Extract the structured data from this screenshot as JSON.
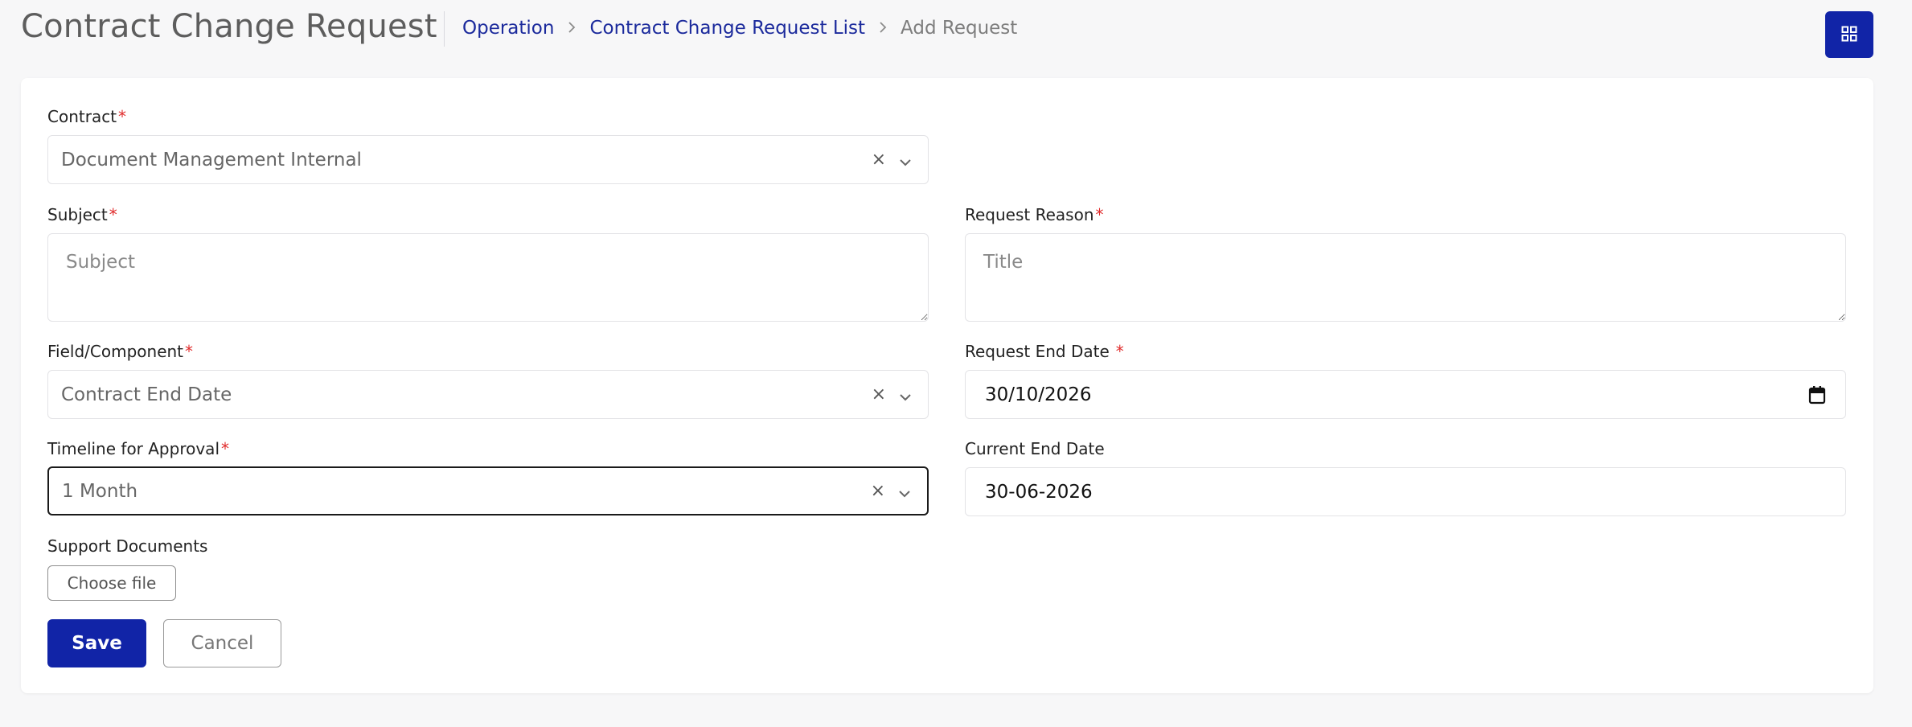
{
  "header": {
    "title": "Contract Change Request",
    "breadcrumb": {
      "items": [
        "Operation",
        "Contract Change Request List"
      ],
      "current": "Add Request"
    },
    "apps_icon": "grid-icon"
  },
  "form": {
    "contract": {
      "label": "Contract",
      "required_mark": "*",
      "value": "Document Management Internal",
      "clear_icon": "×"
    },
    "subject": {
      "label": "Subject",
      "required_mark": "*",
      "placeholder": "Subject",
      "value": ""
    },
    "request_reason": {
      "label": "Request Reason",
      "required_mark": "*",
      "placeholder": "Title",
      "value": ""
    },
    "field_component": {
      "label": "Field/Component",
      "required_mark": "*",
      "value": "Contract End Date",
      "clear_icon": "×"
    },
    "request_end_date": {
      "label": "Request End Date",
      "required_mark": "*",
      "value": "30/10/2026",
      "icon": "calendar-icon"
    },
    "timeline_for_approval": {
      "label": "Timeline for Approval",
      "required_mark": "*",
      "value": "1 Month",
      "clear_icon": "×"
    },
    "current_end_date": {
      "label": "Current End Date",
      "value": "30-06-2026"
    },
    "support_documents": {
      "label": "Support Documents",
      "button_label": "Choose file"
    }
  },
  "actions": {
    "save_label": "Save",
    "cancel_label": "Cancel"
  },
  "colors": {
    "primary": "#1124a7",
    "link": "#1b2a9c",
    "required": "#e02b2b",
    "background": "#f7f7f8"
  }
}
